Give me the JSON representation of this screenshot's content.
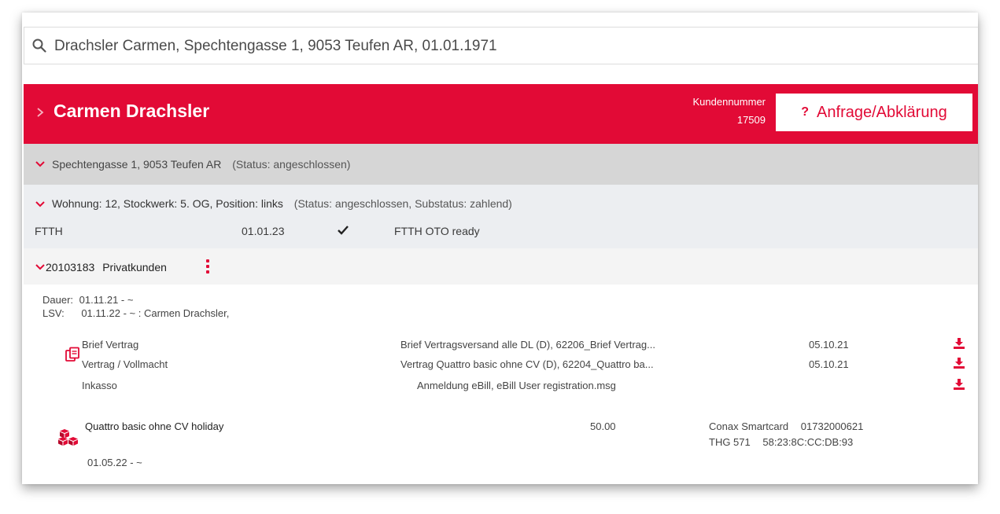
{
  "search": {
    "value": "Drachsler Carmen, Spechtengasse 1, 9053 Teufen AR, 01.01.1971",
    "icon": "search-icon"
  },
  "header": {
    "name": "Carmen Drachsler",
    "kundennummer_label": "Kundennummer",
    "kundennummer_value": "17509",
    "button_mark": "?",
    "button_label": "Anfrage/Abklärung",
    "color": "#e20a36"
  },
  "address": {
    "text": "Spechtengasse 1, 9053 Teufen AR",
    "status": "(Status: angeschlossen)"
  },
  "wohnung": {
    "text": "Wohnung: 12, Stockwerk: 5. OG, Position: links",
    "status": "(Status: angeschlossen, Substatus: zahlend)",
    "service": "FTTH",
    "date": "01.01.23",
    "ready": "FTTH OTO ready"
  },
  "vertrag": {
    "number": "20103183",
    "type": "Privatkunden",
    "dauer_label": "Dauer:",
    "dauer_value": "01.11.21 - ~",
    "lsv_label": "LSV:",
    "lsv_value": "01.11.22 - ~ : Carmen Drachsler,"
  },
  "documents": [
    {
      "type": "Brief Vertrag",
      "file": "Brief Vertragsversand alle DL (D), 62206_Brief Vertrag...",
      "date": "05.10.21"
    },
    {
      "type": "Vertrag / Vollmacht",
      "file": "Vertrag Quattro basic ohne CV (D), 62204_Quattro ba...",
      "date": "05.10.21"
    },
    {
      "type": "Inkasso",
      "file": "Anmeldung eBill, eBill User registration.msg",
      "date": ""
    }
  ],
  "product": {
    "name": "Quattro basic ohne CV holiday",
    "price": "50.00",
    "device1_label": "Conax Smartcard",
    "device1_value": "01732000621",
    "device2_label": "THG 571",
    "device2_value": "58:23:8C:CC:DB:93",
    "date": "01.05.22 - ~"
  }
}
